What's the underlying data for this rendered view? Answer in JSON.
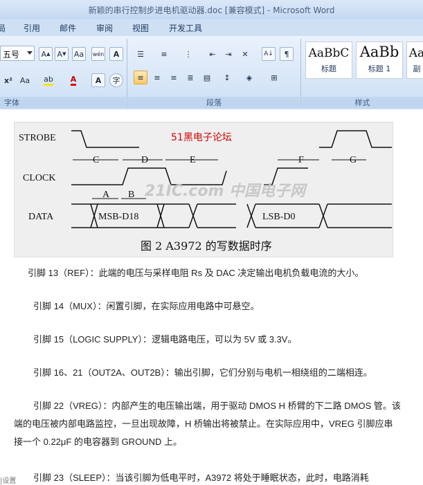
{
  "window": {
    "title": "新颖的串行控制步进电机驱动器.doc [兼容模式] - Microsoft Word"
  },
  "tabs": [
    "局",
    "引用",
    "邮件",
    "审阅",
    "视图",
    "开发工具"
  ],
  "ribbon": {
    "font_size": "五号",
    "groups": {
      "font": "字体",
      "paragraph": "段落",
      "styles": "样式"
    },
    "styles": [
      {
        "preview": "AaBbC",
        "name": "标题"
      },
      {
        "preview": "AaBb",
        "name": "标题 1"
      },
      {
        "preview": "Aa",
        "name": "副"
      }
    ]
  },
  "figure": {
    "watermark": "51黑电子论坛",
    "labels": {
      "strobe": "STROBE",
      "clock": "CLOCK",
      "data": "DATA"
    },
    "interval_labels": [
      "C",
      "D",
      "E",
      "F",
      "G",
      "A",
      "B"
    ],
    "data_msb": "MSB-D18",
    "data_lsb": "LSB-D0",
    "logo": "21IC.com 中国电子网",
    "caption": "图 2   A3972 的写数据时序"
  },
  "paragraphs": [
    "引脚 13（REF）：此端的电压与采样电阻 Rs 及 DAC 决定输出电机负载电流的大小。",
    "引脚 14（MUX）：闲置引脚，在实际应用电路中可悬空。",
    "引脚 15（LOGIC SUPPLY）：逻辑电路电压，可以为 5V 或 3.3V。",
    "引脚 16、21（OUT2A、OUT2B）：输出引脚，它们分别与电机一相绕组的二端相连。",
    "引脚 22（VREG）：内部产生的电压输出端，用于驱动 DMOS H 桥臂的下二路 DMOS 管。该端的电压被内部电路监控，一旦出现故障，H 桥输出将被禁止。在实际应用中，VREG 引脚应串接一个 0.22μF 的电容器到 GROUND 上。",
    "引脚 23（SLEEP）：当该引脚为低电平时，A3972 将处于睡眠状态，此时，电路消耗"
  ],
  "status": {
    "corner": "|设置"
  }
}
